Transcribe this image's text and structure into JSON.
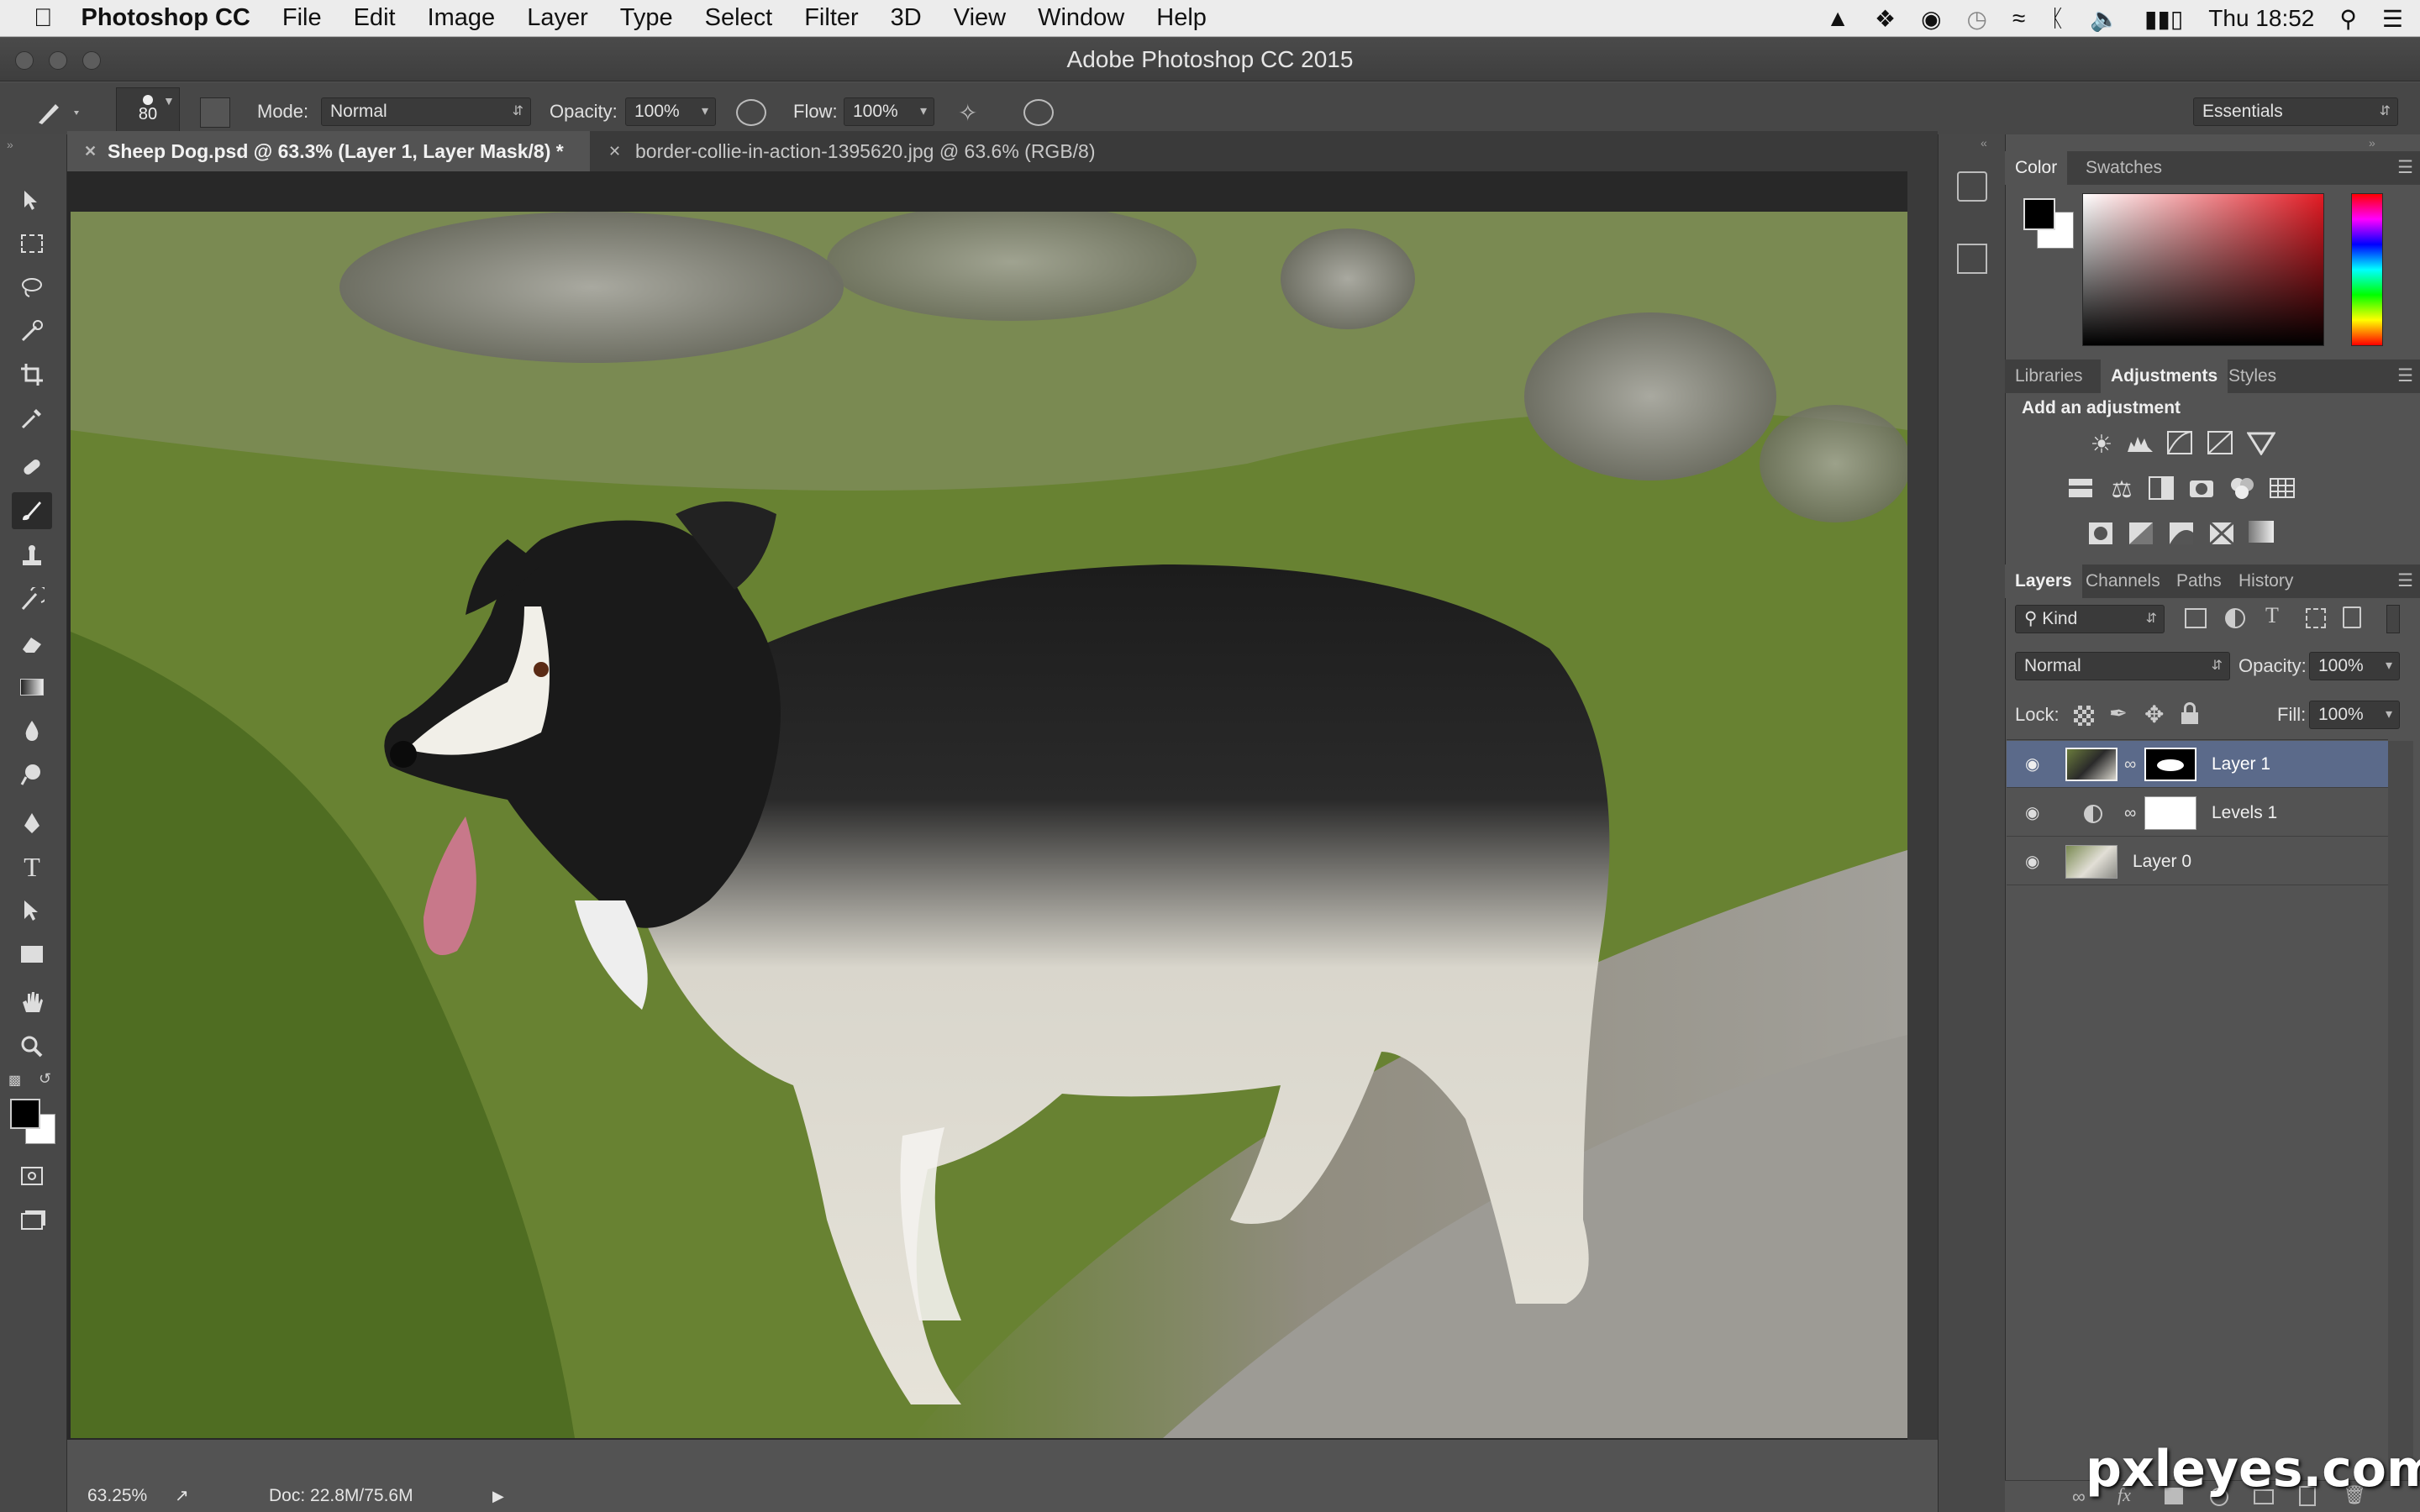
{
  "menubar": {
    "apple_icon": "apple-icon",
    "app_name": "Photoshop CC",
    "items": [
      "File",
      "Edit",
      "Image",
      "Layer",
      "Type",
      "Select",
      "Filter",
      "3D",
      "View",
      "Window",
      "Help"
    ],
    "clock": "Thu 18:52"
  },
  "window": {
    "title": "Adobe Photoshop CC 2015"
  },
  "options": {
    "brush_size": "80",
    "mode_label": "Mode:",
    "mode_value": "Normal",
    "opacity_label": "Opacity:",
    "opacity_value": "100%",
    "flow_label": "Flow:",
    "flow_value": "100%",
    "workspace": "Essentials"
  },
  "tabs": [
    {
      "label": "Sheep Dog.psd @ 63.3% (Layer 1, Layer Mask/8) *",
      "active": true
    },
    {
      "label": "border-collie-in-action-1395620.jpg @ 63.6% (RGB/8)",
      "active": false
    }
  ],
  "status": {
    "zoom": "63.25%",
    "doc": "Doc: 22.8M/75.6M"
  },
  "color_panel": {
    "tabs": [
      "Color",
      "Swatches"
    ],
    "foreground": "#000000",
    "background": "#ffffff"
  },
  "adjustments_panel": {
    "tabs": [
      "Libraries",
      "Adjustments",
      "Styles"
    ],
    "heading": "Add an adjustment"
  },
  "layers_panel": {
    "tabs": [
      "Layers",
      "Channels",
      "Paths",
      "History"
    ],
    "filter": "Kind",
    "blend_mode": "Normal",
    "opacity_label": "Opacity:",
    "opacity_value": "100%",
    "lock_label": "Lock:",
    "fill_label": "Fill:",
    "fill_value": "100%",
    "layers": [
      {
        "name": "Layer 1",
        "selected": true,
        "has_mask": true
      },
      {
        "name": "Levels 1",
        "selected": false,
        "adjustment": true
      },
      {
        "name": "Layer 0",
        "selected": false
      }
    ]
  },
  "watermark": "pxleyes.com",
  "colors": {
    "accent_selected": "#5b6a8a",
    "panel_bg": "#535353",
    "dark_bg": "#282828"
  }
}
